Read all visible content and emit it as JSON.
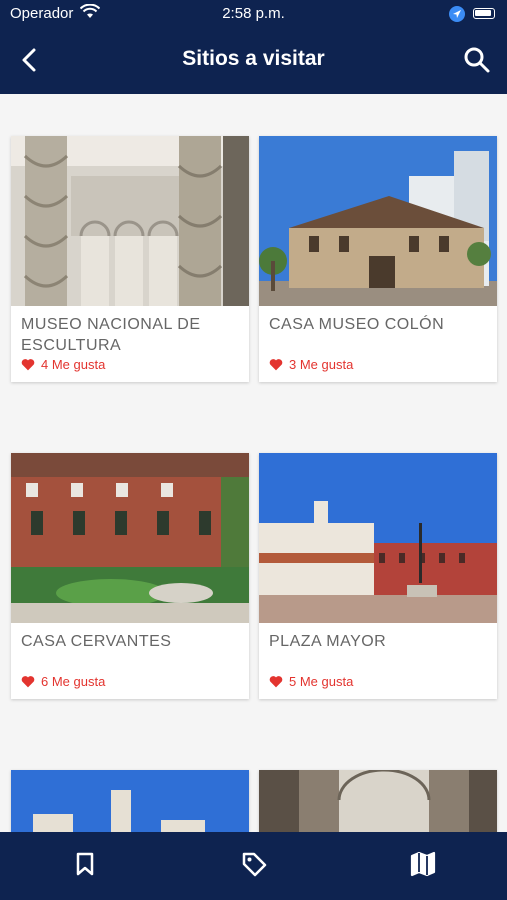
{
  "status_bar": {
    "carrier": "Operador",
    "time": "2:58 p.m."
  },
  "nav": {
    "title": "Sitios a visitar"
  },
  "places": [
    {
      "name": "MUSEO NACIONAL DE ESCULTURA",
      "likes": "4 Me gusta"
    },
    {
      "name": "CASA MUSEO COLÓN",
      "likes": "3 Me gusta"
    },
    {
      "name": "CASA CERVANTES",
      "likes": "6 Me gusta"
    },
    {
      "name": "PLAZA MAYOR",
      "likes": "5 Me gusta"
    }
  ],
  "colors": {
    "primary": "#0e2350",
    "like": "#e3342f",
    "text": "#666666"
  },
  "icons": {
    "back": "chevron-left-icon",
    "search": "search-icon",
    "like": "heart-icon",
    "tabs": [
      "bookmark-icon",
      "tag-icon",
      "map-icon"
    ]
  }
}
